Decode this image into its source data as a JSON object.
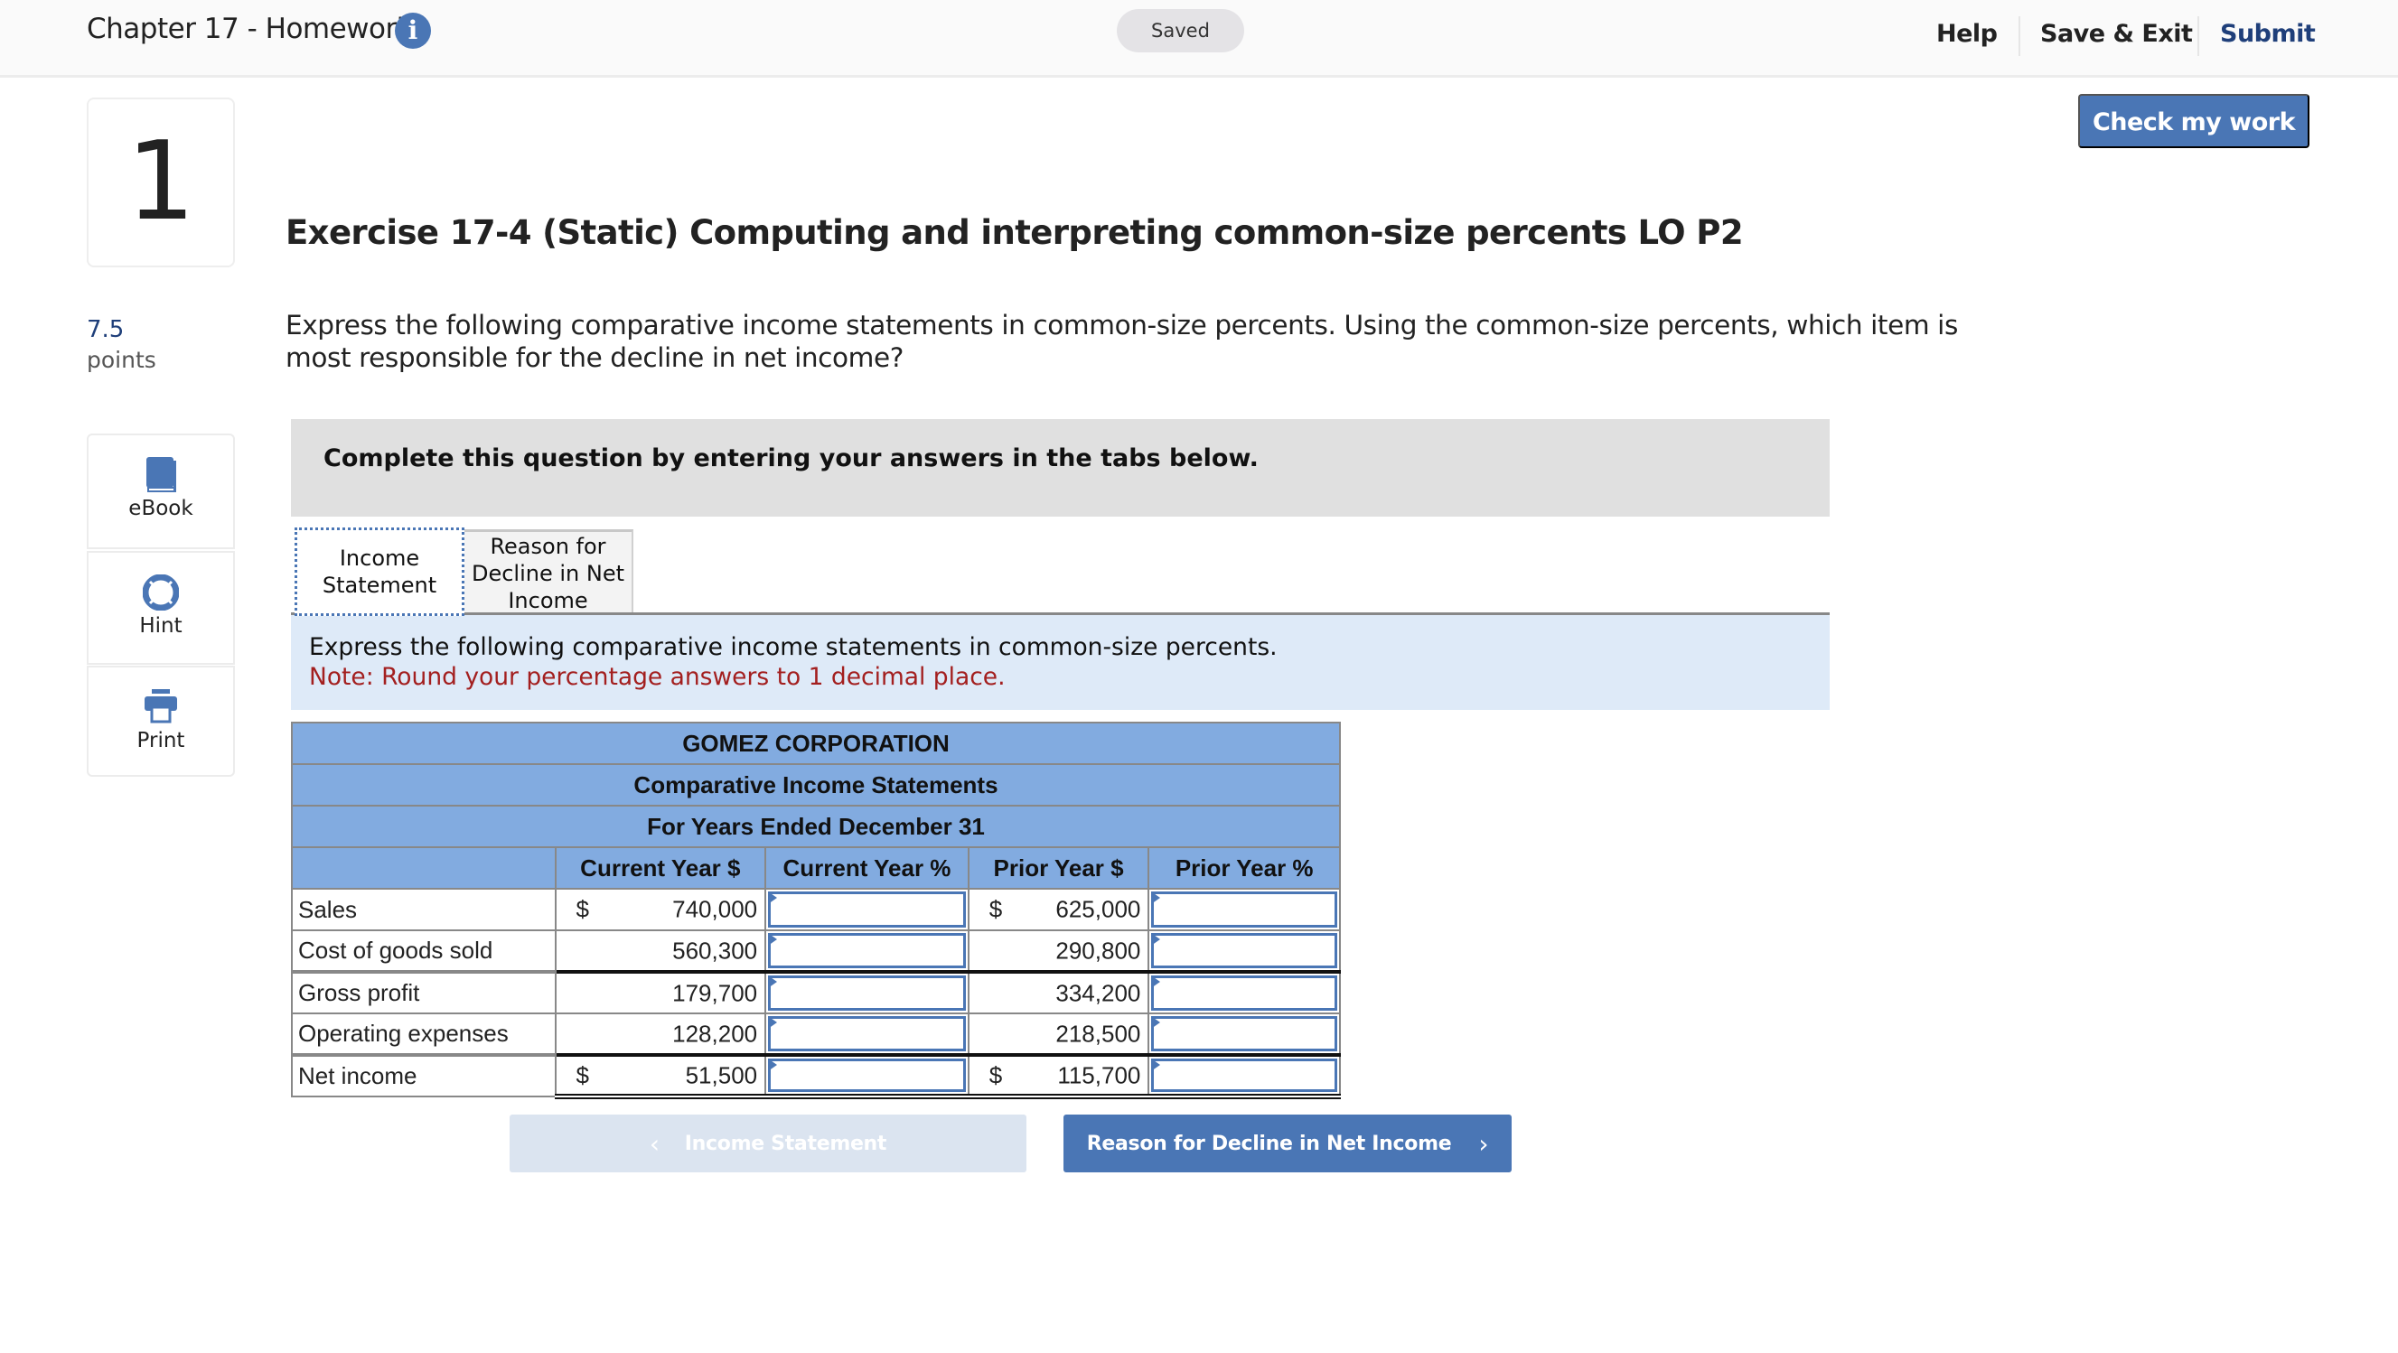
{
  "header": {
    "title": "Chapter 17 - Homework",
    "info_icon": "info-icon",
    "saved_status": "Saved",
    "links": {
      "help": "Help",
      "save_exit": "Save & Exit",
      "submit": "Submit"
    }
  },
  "check_button": "Check my work",
  "question": {
    "number": "1",
    "points_value": "7.5",
    "points_label": "points",
    "title": "Exercise 17-4 (Static) Computing and interpreting common-size percents LO P2",
    "prompt": "Express the following comparative income statements in common-size percents. Using the common-size percents, which item is most responsible for the decline in net income?"
  },
  "tools": [
    {
      "label": "eBook",
      "icon": "book-icon"
    },
    {
      "label": "Hint",
      "icon": "lifebuoy-icon"
    },
    {
      "label": "Print",
      "icon": "printer-icon"
    }
  ],
  "instructions_banner": "Complete this question by entering your answers in the tabs below.",
  "tabs": [
    {
      "label": "Income Statement",
      "active": true
    },
    {
      "label": "Reason for Decline in Net Income",
      "active": false
    }
  ],
  "tab_instructions": {
    "text": "Express the following comparative income statements in common-size percents.",
    "note": "Note: Round your percentage answers to 1 decimal place."
  },
  "statement": {
    "company": "GOMEZ CORPORATION",
    "title": "Comparative Income Statements",
    "period": "For Years Ended December 31",
    "columns": [
      "",
      "Current Year $",
      "Current Year %",
      "Prior Year $",
      "Prior Year %"
    ],
    "rows": [
      {
        "label": "Sales",
        "cy_cur": "$",
        "cy": "740,000",
        "cy_pct": "",
        "py_cur": "$",
        "py": "625,000",
        "py_pct": ""
      },
      {
        "label": "Cost of goods sold",
        "cy_cur": "",
        "cy": "560,300",
        "cy_pct": "",
        "py_cur": "",
        "py": "290,800",
        "py_pct": ""
      },
      {
        "label": "Gross profit",
        "cy_cur": "",
        "cy": "179,700",
        "cy_pct": "",
        "py_cur": "",
        "py": "334,200",
        "py_pct": ""
      },
      {
        "label": "Operating expenses",
        "cy_cur": "",
        "cy": "128,200",
        "cy_pct": "",
        "py_cur": "",
        "py": "218,500",
        "py_pct": ""
      },
      {
        "label": "Net income",
        "cy_cur": "$",
        "cy": "51,500",
        "cy_pct": "",
        "py_cur": "$",
        "py": "115,700",
        "py_pct": ""
      }
    ]
  },
  "bottom_nav": {
    "prev_label": "Income Statement",
    "next_label": "Reason for Decline in Net Income",
    "prev_disabled": true
  },
  "colors": {
    "accent": "#4a76b5",
    "table_header": "#82abe0",
    "note_red": "#a31f1f",
    "instr_bg": "#deeaf8"
  }
}
